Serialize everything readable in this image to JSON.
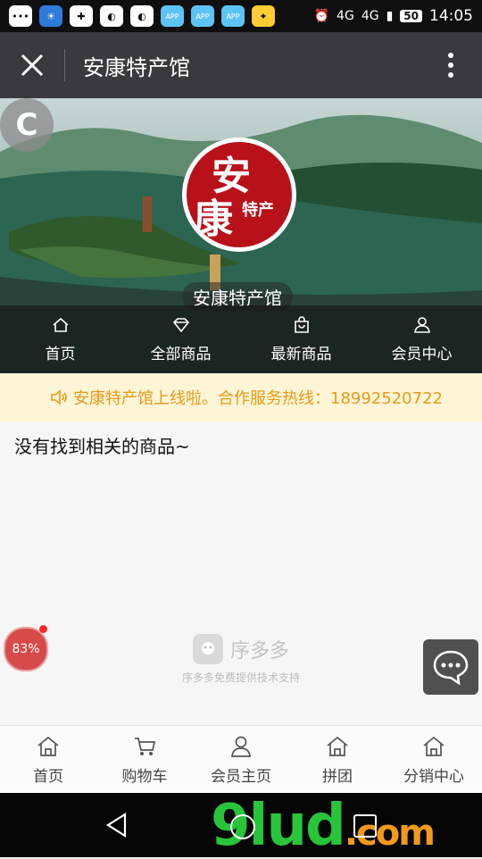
{
  "status_bar": {
    "network_labels": [
      "4G",
      "4G"
    ],
    "battery": "50",
    "time": "14:05",
    "app_icon_label": "APP"
  },
  "title_bar": {
    "title": "安康特产馆"
  },
  "banner": {
    "corner_badge": "C",
    "logo_big_chars": [
      "安",
      "康"
    ],
    "logo_small": "特产",
    "store_name": "安康特产馆",
    "nav": [
      {
        "label": "首页",
        "icon": "home-icon"
      },
      {
        "label": "全部商品",
        "icon": "diamond-icon"
      },
      {
        "label": "最新商品",
        "icon": "bag-icon"
      },
      {
        "label": "会员中心",
        "icon": "user-icon"
      }
    ]
  },
  "notice": {
    "text": "安康特产馆上线啦。合作服务热线：18992520722"
  },
  "content": {
    "empty_message": "没有找到相关的商品~",
    "progress_percent": "83%",
    "brand_name": "序多多",
    "brand_sub": "序多多免费提供技术支持"
  },
  "tabbar": [
    {
      "label": "首页",
      "icon": "home-icon"
    },
    {
      "label": "购物车",
      "icon": "cart-icon"
    },
    {
      "label": "会员主页",
      "icon": "user-icon"
    },
    {
      "label": "拼团",
      "icon": "home-icon"
    },
    {
      "label": "分销中心",
      "icon": "home-icon"
    }
  ],
  "watermark": {
    "text": "9lud",
    "suffix": ".com"
  }
}
